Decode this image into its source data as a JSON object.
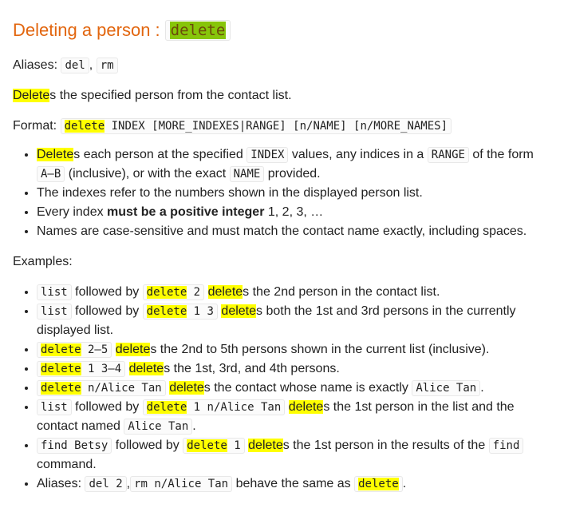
{
  "heading": {
    "text": "Deleting a person :",
    "command": "delete"
  },
  "aliases": {
    "label": "Aliases:",
    "items": [
      "del",
      "rm"
    ],
    "sep": ","
  },
  "description": {
    "hl": "Delete",
    "rest": "s the specified person from the contact list."
  },
  "format": {
    "label": "Format:",
    "cmd": "delete",
    "args": " INDEX [MORE_INDEXES|RANGE] [n/NAME] [n/MORE_NAMES]"
  },
  "bullets": {
    "b1": {
      "hl": "Delete",
      "t1": "s each person at the specified",
      "c1": "INDEX",
      "t2": "values, any indices in a",
      "c2": "RANGE",
      "t3": "of the form",
      "c3": "A–B",
      "t4": "(inclusive), or with the exact",
      "c4": "NAME",
      "t5": "provided."
    },
    "b2": "The indexes refer to the numbers shown in the displayed person list.",
    "b3": {
      "pre": "Every index ",
      "bold": "must be a positive integer",
      "post": " 1, 2, 3, …"
    },
    "b4": "Names are case-sensitive and must match the contact name exactly, including spaces."
  },
  "examples_title": "Examples:",
  "examples": {
    "e1": {
      "c1": "list",
      "t1": "followed by",
      "cmd": "delete",
      "args": " 2",
      "hl": "delete",
      "rest": "s the 2nd person in the contact list."
    },
    "e2": {
      "c1": "list",
      "t1": "followed by",
      "cmd": "delete",
      "args": " 1 3",
      "hl": "delete",
      "rest": "s both the 1st and 3rd persons in the currently displayed list."
    },
    "e3": {
      "cmd": "delete",
      "args": " 2–5",
      "hl": "delete",
      "rest": "s the 2nd to 5th persons shown in the current list (inclusive)."
    },
    "e4": {
      "cmd": "delete",
      "args": " 1 3–4",
      "hl": "delete",
      "rest": "s the 1st, 3rd, and 4th persons."
    },
    "e5": {
      "cmd": "delete",
      "args": " n/Alice Tan",
      "hl": "delete",
      "rest": "s the contact whose name is exactly",
      "c2": "Alice Tan",
      "end": "."
    },
    "e6": {
      "c1": "list",
      "t1": "followed by",
      "cmd": "delete",
      "args": " 1 n/Alice Tan",
      "hl": "delete",
      "rest": "s the 1st person in the list and the contact named",
      "c2": "Alice Tan",
      "end": "."
    },
    "e7": {
      "c1": "find Betsy",
      "t1": "followed by",
      "cmd": "delete",
      "args": " 1",
      "hl": "delete",
      "rest": "s the 1st person in the results of the",
      "c2": "find",
      "end": "command."
    },
    "e8": {
      "label": "Aliases:",
      "c1": "del 2",
      "sep": ",",
      "c2": "rm n/Alice Tan",
      "t1": "behave the same as",
      "cmd": "delete",
      "end": "."
    }
  }
}
